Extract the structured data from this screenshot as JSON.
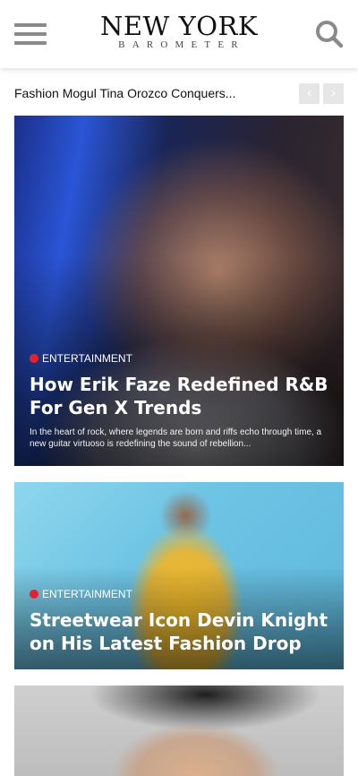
{
  "header": {
    "logo_main": "NEW YORK",
    "logo_sub": "BAROMETER"
  },
  "ticker": {
    "text": "Fashion Mogul Tina Orozco Conquers...",
    "prev_label": "‹",
    "next_label": "›"
  },
  "articles": [
    {
      "category": "ENTERTAINMENT",
      "title": "How Erik Faze Redefined R&B For Gen X Trends",
      "excerpt": "In the heart of rock, where legends are born and riffs echo through time, a new guitar virtuoso is redefining the sound of rebellion..."
    },
    {
      "category": "ENTERTAINMENT",
      "title": "Streetwear Icon Devin Knight on His Latest Fashion Drop"
    }
  ],
  "icons": {
    "menu": "hamburger-menu-icon",
    "search": "search-icon",
    "category_dot": "red-dot-icon"
  },
  "colors": {
    "accent": "#e6202e",
    "icon_gray": "#8a8a8a"
  }
}
